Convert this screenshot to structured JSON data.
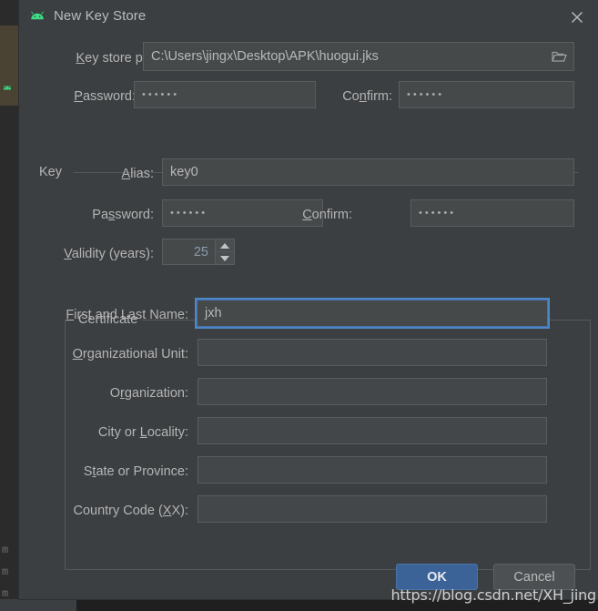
{
  "background": {
    "gutter_marks": [
      "m",
      "m",
      "m"
    ],
    "android_icon": "android-head-icon"
  },
  "dialog": {
    "title": "New Key Store",
    "title_icon": "android-head-icon",
    "close_icon": "close-icon",
    "keystore": {
      "path_label": "Key store path:",
      "path_mnemonic": "K",
      "path_label_rest": "ey store path:",
      "path_value": "C:\\Users\\jingx\\Desktop\\APK\\huogui.jks",
      "browse_icon": "folder-icon",
      "password_label_mnemonic": "P",
      "password_label_rest": "assword:",
      "password_value": "••••••",
      "confirm_label_pre": "Co",
      "confirm_label_mnemonic": "n",
      "confirm_label_rest": "firm:",
      "confirm_value": "••••••"
    },
    "key_group": {
      "title": "Key",
      "alias_label_mnemonic": "A",
      "alias_label_rest": "lias:",
      "alias_value": "key0",
      "password_label_pre": "Pa",
      "password_label_mnemonic": "s",
      "password_label_rest": "sword:",
      "password_value": "••••••",
      "confirm_label_mnemonic": "C",
      "confirm_label_rest": "onfirm:",
      "confirm_value": "••••••",
      "validity_label_mnemonic": "V",
      "validity_label_rest": "alidity (years):",
      "validity_value": "25",
      "spinner_up_icon": "chevron-up-icon",
      "spinner_down_icon": "chevron-down-icon"
    },
    "certificate_group": {
      "title": "Certificate",
      "rows": [
        {
          "label_mnemonic": "F",
          "label_rest": "irst and Last Name:",
          "value": "jxh",
          "focused": true
        },
        {
          "label_mnemonic": "O",
          "label_rest": "rganizational Unit:",
          "value": "",
          "focused": false
        },
        {
          "label_pre": "O",
          "label_mnemonic": "r",
          "label_rest": "ganization:",
          "value": "",
          "focused": false
        },
        {
          "label_pre": "City or ",
          "label_mnemonic": "L",
          "label_rest": "ocality:",
          "value": "",
          "focused": false
        },
        {
          "label_pre": "S",
          "label_mnemonic": "t",
          "label_rest": "ate or Province:",
          "value": "",
          "focused": false
        },
        {
          "label_pre": "Country Code (",
          "label_mnemonic": "X",
          "label_rest": "X):",
          "value": "",
          "focused": false
        }
      ]
    },
    "buttons": {
      "ok": "OK",
      "cancel": "Cancel"
    }
  },
  "watermark": {
    "text": "https://blog.csdn.net/XH_jing"
  },
  "colors": {
    "dialog_bg": "#3c3f41",
    "field_bg": "#45494a",
    "accent_focus": "#4a88c7",
    "ok_button": "#3c6398",
    "android_green": "#3ddc84",
    "text": "#b4b4b4"
  }
}
